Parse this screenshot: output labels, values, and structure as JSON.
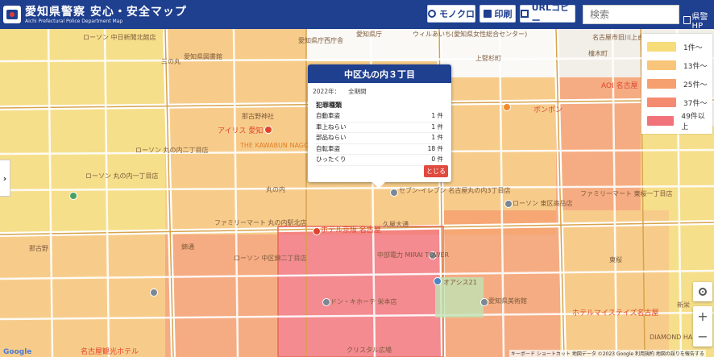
{
  "header": {
    "title": "愛知県警察 安心・安全マップ",
    "subtitle": "Aichi Prefectural Police Department Map",
    "buttons": {
      "monochrome": "モノクロ",
      "print": "印刷",
      "url_copy": "URLコピー"
    },
    "search_placeholder": "検索",
    "hp_link": "県警HP"
  },
  "legend": {
    "items": [
      {
        "label": "1件〜",
        "color": "#f7dc7a"
      },
      {
        "label": "13件〜",
        "color": "#f8c57a"
      },
      {
        "label": "25件〜",
        "color": "#f6a070"
      },
      {
        "label": "37件〜",
        "color": "#f48a70"
      },
      {
        "label": "49件以上",
        "color": "#f2727a"
      }
    ]
  },
  "popup": {
    "title": "中区丸の内３丁目",
    "year": "2022年：",
    "period": "全期間",
    "category_header": "犯罪種類",
    "rows": [
      {
        "name": "自動車盗",
        "count": "1 件"
      },
      {
        "name": "車上ねらい",
        "count": "1 件"
      },
      {
        "name": "部品ねらい",
        "count": "1 件"
      },
      {
        "name": "自転車盗",
        "count": "18 件"
      },
      {
        "name": "ひったくり",
        "count": "0 件"
      }
    ],
    "close_label": "とじる"
  },
  "map": {
    "labels": [
      {
        "text": "ローソン 中日新聞北館店",
        "color": "brown"
      },
      {
        "text": "三の丸",
        "color": "brown"
      },
      {
        "text": "愛知県図書館",
        "color": "brown"
      },
      {
        "text": "愛知県庁西庁舎",
        "color": "brown"
      },
      {
        "text": "愛知県庁",
        "color": "brown"
      },
      {
        "text": "ウィルあいち(愛知県女性総合センター)",
        "color": "brown"
      },
      {
        "text": "上竪杉町",
        "color": "brown"
      },
      {
        "text": "橦木町",
        "color": "brown"
      },
      {
        "text": "名古屋市旧川上貞",
        "color": "brown"
      },
      {
        "text": "那古野神社",
        "color": "brown"
      },
      {
        "text": "アイリス 愛知",
        "color": "red"
      },
      {
        "text": "THE KAWABUN NAGOYA レストラン",
        "color": "orange"
      },
      {
        "text": "ローソン 丸の内二丁目店",
        "color": "brown"
      },
      {
        "text": "ローソン 丸の内一丁目店",
        "color": "brown"
      },
      {
        "text": "ホテル京阪 名古屋",
        "color": "red"
      },
      {
        "text": "丸の内",
        "color": "brown"
      },
      {
        "text": "ファミリーマート 丸の内駅北店",
        "color": "brown"
      },
      {
        "text": "セブン-イレブン 名古屋丸の内3丁目店",
        "color": "brown"
      },
      {
        "text": "中部電力 MIRAI TOWER",
        "color": "brown"
      },
      {
        "text": "久屋大通",
        "color": "brown"
      },
      {
        "text": "オアシス21",
        "color": "brown"
      },
      {
        "text": "愛知県美術館",
        "color": "brown"
      },
      {
        "text": "ドン・キホーテ 栄本店",
        "color": "brown"
      },
      {
        "text": "クリスタル広場",
        "color": "brown"
      },
      {
        "text": "ローソン 中区錦二丁目店",
        "color": "brown"
      },
      {
        "text": "ローソン 東区高岳店",
        "color": "brown"
      },
      {
        "text": "ファミリーマート 東桜一丁目店",
        "color": "brown"
      },
      {
        "text": "ボンボン",
        "color": "red"
      },
      {
        "text": "AOI 名古屋",
        "color": "red"
      },
      {
        "text": "名古屋観光ホテル",
        "color": "red"
      },
      {
        "text": "那古野",
        "color": "brown"
      },
      {
        "text": "東桜",
        "color": "brown"
      },
      {
        "text": "新栄",
        "color": "brown"
      },
      {
        "text": "DIAMOND HALL",
        "color": "brown"
      },
      {
        "text": "ホテルマイステイズ名古屋",
        "color": "red"
      },
      {
        "text": "錦通",
        "color": "brown"
      }
    ]
  },
  "controls": {
    "zoom_in": "+",
    "zoom_out": "−"
  },
  "attribution": "キーボード ショートカット 地図データ ©2023 Google 利用規約 地図の誤りを報告する",
  "google_logo": "Google"
}
